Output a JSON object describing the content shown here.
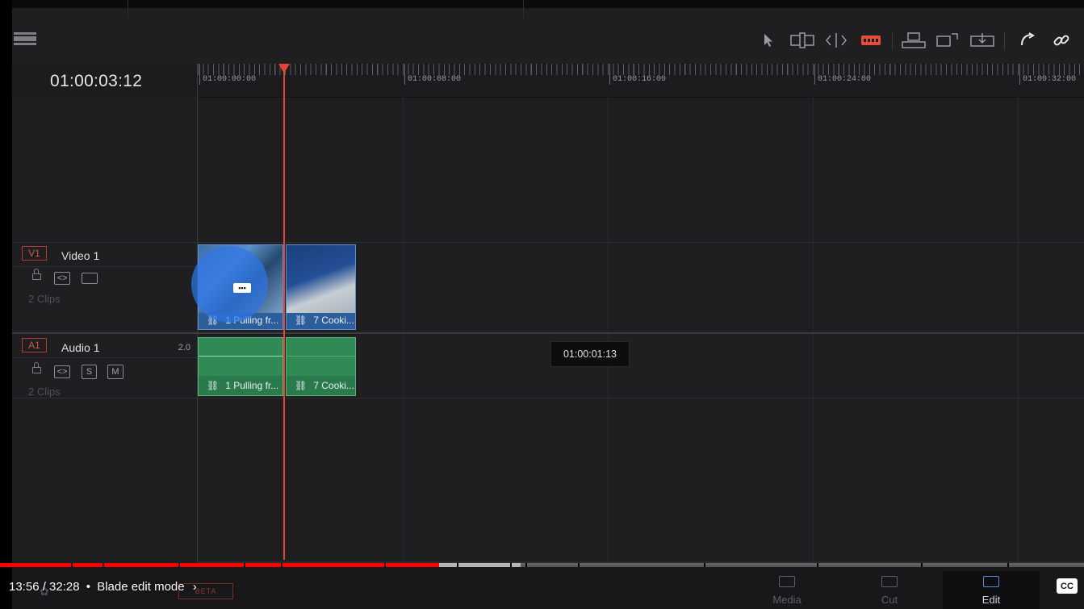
{
  "timecode": "01:00:03:12",
  "ruler": {
    "labels": [
      "01:00:00:00",
      "01:00:08:00",
      "01:00:16:00",
      "01:00:24:00",
      "01:00:32:00"
    ]
  },
  "toolbar": {
    "tools": [
      "select-pointer",
      "trim-edit",
      "dynamic-trim",
      "blade-edit",
      "insert-clip",
      "overwrite-clip",
      "replace-clip",
      "snapping",
      "linked-selection"
    ],
    "active_tool": "blade-edit",
    "accent": "#e64b3c"
  },
  "tracks": {
    "video": {
      "badge": "V1",
      "name": "Video 1",
      "clips_count": "2 Clips"
    },
    "audio": {
      "badge": "A1",
      "name": "Audio 1",
      "channels": "2.0",
      "solo": "S",
      "mute": "M",
      "clips_count": "2 Clips"
    }
  },
  "clips": {
    "video": [
      {
        "label": "1 Pulling fr..."
      },
      {
        "label": "7 Cooki..."
      }
    ],
    "audio": [
      {
        "label": "1 Pulling fr..."
      },
      {
        "label": "7 Cooki..."
      }
    ]
  },
  "tooltip": "01:00:01:13",
  "pages": [
    {
      "label": "Media"
    },
    {
      "label": "Cut"
    },
    {
      "label": "Edit",
      "active": true
    }
  ],
  "beta_badge": "BETA",
  "player": {
    "time": "13:56 / 32:28",
    "separator": "•",
    "chapter": "Blade edit mode",
    "cc": "CC",
    "progress": 0.405,
    "buffered": 0.48
  }
}
